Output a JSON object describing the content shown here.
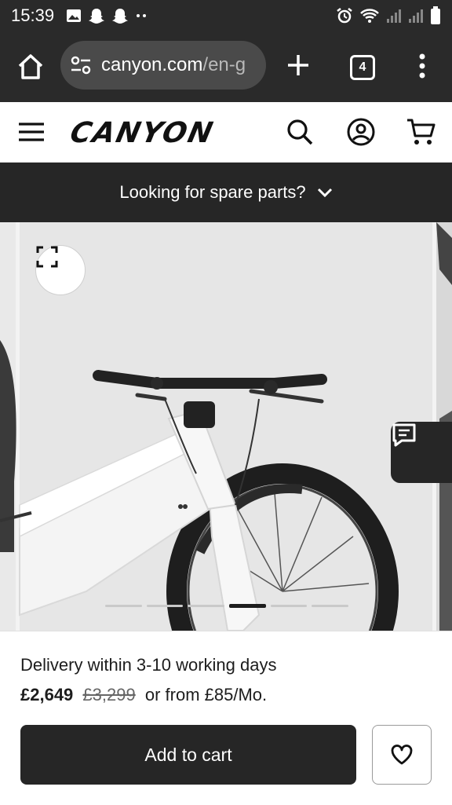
{
  "status_bar": {
    "time": "15:39"
  },
  "browser": {
    "url_host": "canyon.com",
    "url_path": "/en-g",
    "tab_count": "4"
  },
  "header": {
    "logo_text": "CANYON"
  },
  "banner": {
    "text": "Looking for spare parts?"
  },
  "gallery": {
    "slide_count": 6,
    "active_slide": 4
  },
  "product": {
    "delivery": "Delivery within 3-10 working days",
    "price_now": "£2,649",
    "price_old": "£3,299",
    "price_finance": "or from £85/Mo."
  },
  "actions": {
    "add_to_cart": "Add to cart"
  },
  "colors": {
    "dark": "#262626",
    "chrome_bar": "#2a2a2a",
    "gallery_bg": "#f3f3f3"
  }
}
